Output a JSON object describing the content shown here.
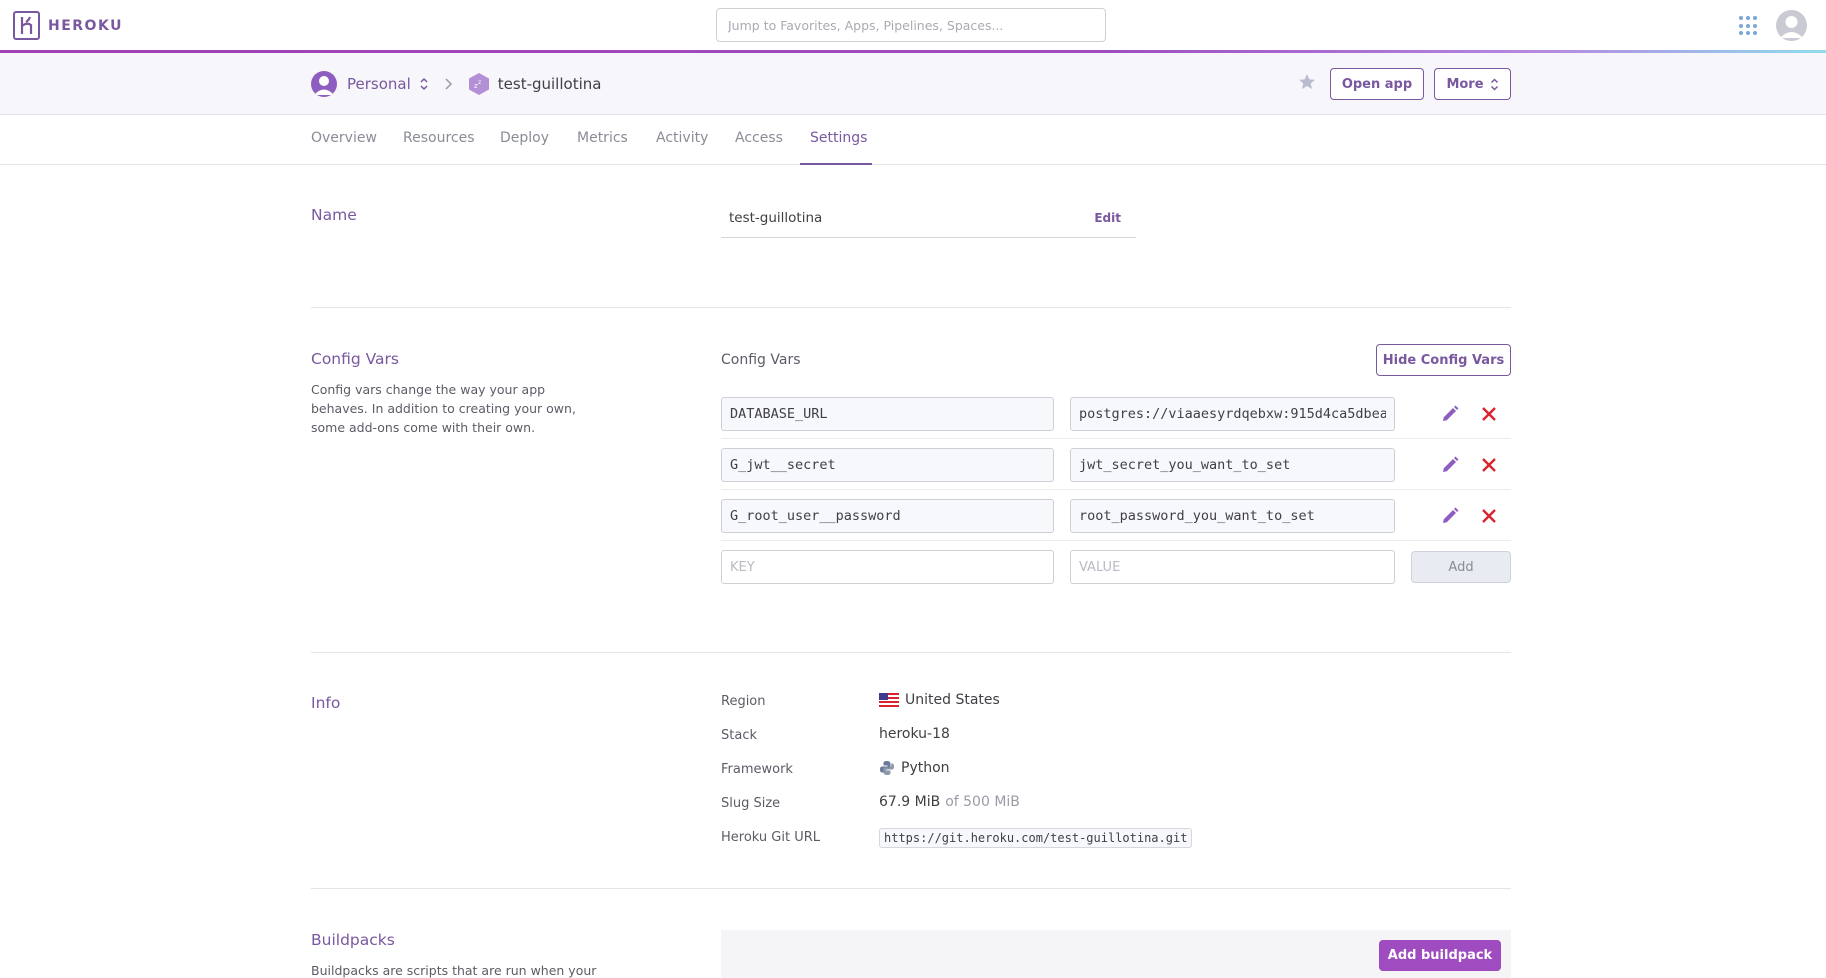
{
  "header": {
    "logo_text": "HEROKU",
    "search_placeholder": "Jump to Favorites, Apps, Pipelines, Spaces..."
  },
  "app_header": {
    "account": "Personal",
    "app_name": "test-guillotina",
    "open_app_label": "Open app",
    "more_label": "More"
  },
  "tabs": [
    "Overview",
    "Resources",
    "Deploy",
    "Metrics",
    "Activity",
    "Access",
    "Settings"
  ],
  "active_tab": "Settings",
  "name_section": {
    "title": "Name",
    "value": "test-guillotina",
    "edit_label": "Edit"
  },
  "config_vars": {
    "title": "Config Vars",
    "description": "Config vars change the way your app behaves. In addition to creating your own, some add-ons come with their own.",
    "heading": "Config Vars",
    "hide_label": "Hide Config Vars",
    "rows": [
      {
        "key": "DATABASE_URL",
        "value": "postgres://viaaesyrdqebxw:915d4ca5dbea"
      },
      {
        "key": "G_jwt__secret",
        "value": "jwt_secret_you_want_to_set"
      },
      {
        "key": "G_root_user__password",
        "value": "root_password_you_want_to_set"
      }
    ],
    "key_placeholder": "KEY",
    "value_placeholder": "VALUE",
    "add_label": "Add"
  },
  "info": {
    "title": "Info",
    "region_label": "Region",
    "region_value": "United States",
    "stack_label": "Stack",
    "stack_value": "heroku-18",
    "framework_label": "Framework",
    "framework_value": "Python",
    "slug_label": "Slug Size",
    "slug_value": "67.9 MiB",
    "slug_limit": "of 500 MiB",
    "git_label": "Heroku Git URL",
    "git_value": "https://git.heroku.com/test-guillotina.git"
  },
  "buildpacks": {
    "title": "Buildpacks",
    "description": "Buildpacks are scripts that are run when your",
    "add_label": "Add buildpack"
  },
  "colors": {
    "brand": "#79589f",
    "danger": "#d9232e",
    "add_buildpack": "#9e4cbf"
  },
  "icons": [
    "apps-grid-icon",
    "user-avatar-icon",
    "up-down-chevron-icon",
    "chevron-right-icon",
    "sleeping-dyno-icon",
    "star-icon",
    "pencil-icon",
    "close-icon",
    "us-flag-icon",
    "python-icon"
  ]
}
